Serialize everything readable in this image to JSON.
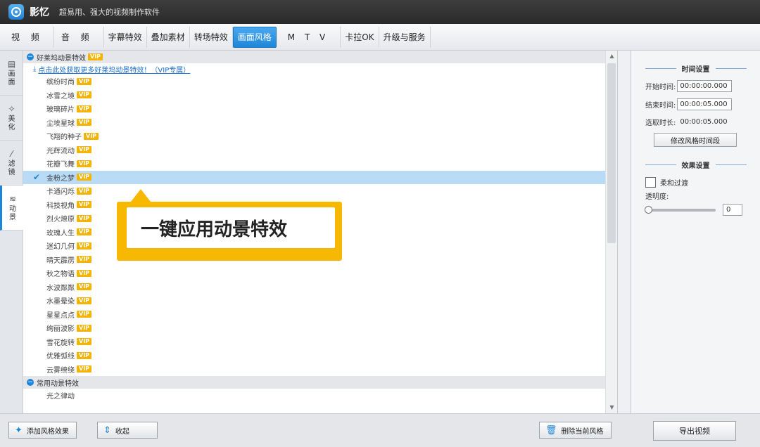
{
  "app": {
    "name": "影忆",
    "tagline": "超易用、强大的视频制作软件"
  },
  "tabs": [
    {
      "label": "视 频"
    },
    {
      "label": "音 频"
    },
    {
      "label": "字幕特效"
    },
    {
      "label": "叠加素材"
    },
    {
      "label": "转场特效"
    },
    {
      "label": "画面风格",
      "active": true
    },
    {
      "label": "M T V"
    },
    {
      "label": "卡拉OK"
    },
    {
      "label": "升级与服务"
    }
  ],
  "side_tabs": [
    {
      "label": "画面",
      "icon": "picture-icon"
    },
    {
      "label": "美化",
      "icon": "magic-wand-icon"
    },
    {
      "label": "滤镜",
      "icon": "filter-icon"
    },
    {
      "label": "动景",
      "icon": "motion-icon",
      "active": true
    }
  ],
  "list": {
    "group1": {
      "title": "好莱坞动景特效",
      "badge": "VIP",
      "promo": "点击此处获取更多好莱坞动景特效！（VIP专属）",
      "items": [
        "缤纷时尚",
        "冰雪之境",
        "玻璃碎片",
        "尘埃星球",
        "飞翔的种子",
        "光辉流动",
        "花瓣飞舞",
        "金粉之梦",
        "卡通闪烁",
        "科技视角",
        "烈火燎原",
        "玫瑰人生",
        "迷幻几何",
        "晴天霹雳",
        "秋之物语",
        "水波粼粼",
        "水墨晕染",
        "星星点点",
        "绚丽波影",
        "雪花旋转",
        "优雅弧线",
        "云雾缭绕"
      ],
      "selected_index": 7
    },
    "group2": {
      "title": "常用动景特效",
      "items": [
        "光之律动"
      ]
    }
  },
  "callout": {
    "text": "一键应用动景特效"
  },
  "right_panel": {
    "time_title": "时间设置",
    "start_label": "开始时间:",
    "start_value": "00:00:00.000",
    "end_label": "结束时间:",
    "end_value": "00:00:05.000",
    "duration_label": "选取时长:",
    "duration_value": "00:00:05.000",
    "modify_button": "修改风格时间段",
    "effect_title": "效果设置",
    "smooth_label": "柔和过渡",
    "smooth_checked": false,
    "opacity_label": "透明度:",
    "opacity_value": "0"
  },
  "bottom": {
    "add_button": "添加风格效果",
    "collapse_button": "收起",
    "delete_button": "删除当前风格",
    "export_button": "导出视频"
  }
}
